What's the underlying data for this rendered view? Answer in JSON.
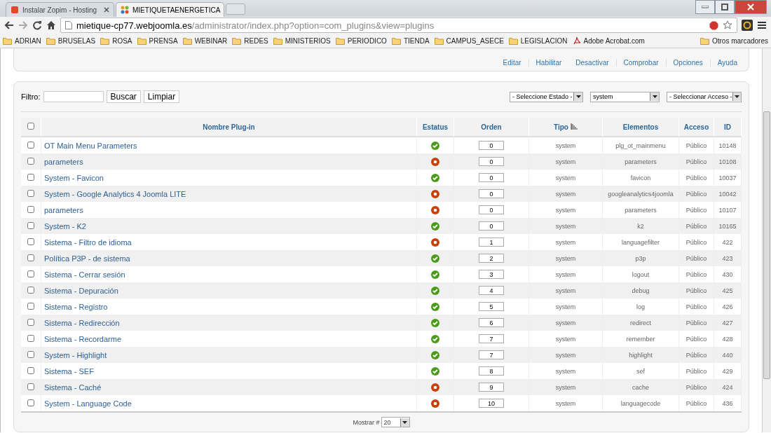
{
  "browser": {
    "tabs": [
      {
        "label": "Instalar Zopim - Hosting",
        "selected": false
      },
      {
        "label": "MIETIQUETAENERGETICA",
        "selected": true
      }
    ],
    "address": {
      "host": "mietique-cp77.webjoomla.es",
      "path": "/administrator/index.php?option=com_plugins&view=plugins"
    },
    "bookmarks": [
      {
        "label": "ADRIAN",
        "kind": "folder"
      },
      {
        "label": "BRUSELAS",
        "kind": "folder"
      },
      {
        "label": "ROSA",
        "kind": "folder"
      },
      {
        "label": "PRENSA",
        "kind": "folder"
      },
      {
        "label": "WEBINAR",
        "kind": "folder"
      },
      {
        "label": "REDES",
        "kind": "folder"
      },
      {
        "label": "MINISTERIOS",
        "kind": "folder"
      },
      {
        "label": "PERIODICO",
        "kind": "folder"
      },
      {
        "label": "TIENDA",
        "kind": "folder"
      },
      {
        "label": "CAMPUS_ASECE",
        "kind": "folder"
      },
      {
        "label": "LEGISLACION",
        "kind": "folder"
      },
      {
        "label": "Adobe Acrobat.com",
        "kind": "pdf"
      }
    ],
    "other_bookmarks": "Otros marcadores"
  },
  "toolbar": [
    "Editar",
    "Habilitar",
    "Desactivar",
    "Comprobar",
    "Opciones",
    "Ayuda"
  ],
  "filter": {
    "label": "Filtro:",
    "buttons": [
      "Buscar",
      "Limpiar"
    ],
    "selects": [
      "- Seleccione Estado -",
      "system",
      "- Seleccionar Acceso -"
    ]
  },
  "table": {
    "select_all_checked": false,
    "columns": [
      "Nombre Plug-in",
      "Estatus",
      "Orden",
      "Tipo",
      "Elementos",
      "Acceso",
      "ID"
    ],
    "rows": [
      {
        "checked": false,
        "name": "OT Main Menu Parameters",
        "enabled": true,
        "order": "0",
        "type": "system",
        "element": "plg_ot_mainmenu",
        "access": "Público",
        "id": "10148"
      },
      {
        "checked": false,
        "name": "parameters",
        "enabled": false,
        "order": "0",
        "type": "system",
        "element": "parameters",
        "access": "Público",
        "id": "10108"
      },
      {
        "checked": false,
        "name": "System - Favicon",
        "enabled": true,
        "order": "0",
        "type": "system",
        "element": "favicon",
        "access": "Público",
        "id": "10037"
      },
      {
        "checked": false,
        "name": "System - Google Analytics 4 Joomla LITE",
        "enabled": false,
        "order": "0",
        "type": "system",
        "element": "googleanalytics4joomla",
        "access": "Público",
        "id": "10042"
      },
      {
        "checked": false,
        "name": "parameters",
        "enabled": false,
        "order": "0",
        "type": "system",
        "element": "parameters",
        "access": "Público",
        "id": "10107"
      },
      {
        "checked": false,
        "name": "System - K2",
        "enabled": true,
        "order": "0",
        "type": "system",
        "element": "k2",
        "access": "Público",
        "id": "10165"
      },
      {
        "checked": false,
        "name": "Sistema - Filtro de idioma",
        "enabled": false,
        "order": "1",
        "type": "system",
        "element": "languagefilter",
        "access": "Público",
        "id": "422"
      },
      {
        "checked": false,
        "name": "Política P3P - de sistema",
        "enabled": true,
        "order": "2",
        "type": "system",
        "element": "p3p",
        "access": "Público",
        "id": "423"
      },
      {
        "checked": false,
        "name": "Sistema - Cerrar sesión",
        "enabled": true,
        "order": "3",
        "type": "system",
        "element": "logout",
        "access": "Público",
        "id": "430"
      },
      {
        "checked": false,
        "name": "Sistema - Depuración",
        "enabled": true,
        "order": "4",
        "type": "system",
        "element": "debug",
        "access": "Público",
        "id": "425"
      },
      {
        "checked": false,
        "name": "Sistema - Registro",
        "enabled": true,
        "order": "5",
        "type": "system",
        "element": "log",
        "access": "Público",
        "id": "426"
      },
      {
        "checked": false,
        "name": "Sistema - Redirección",
        "enabled": true,
        "order": "6",
        "type": "system",
        "element": "redirect",
        "access": "Público",
        "id": "427"
      },
      {
        "checked": false,
        "name": "Sistema - Recordarme",
        "enabled": true,
        "order": "7",
        "type": "system",
        "element": "remember",
        "access": "Público",
        "id": "428"
      },
      {
        "checked": false,
        "name": "System - Highlight",
        "enabled": true,
        "order": "7",
        "type": "system",
        "element": "highlight",
        "access": "Público",
        "id": "440"
      },
      {
        "checked": false,
        "name": "Sistema - SEF",
        "enabled": true,
        "order": "8",
        "type": "system",
        "element": "sef",
        "access": "Público",
        "id": "429"
      },
      {
        "checked": false,
        "name": "Sistema - Caché",
        "enabled": false,
        "order": "9",
        "type": "system",
        "element": "cache",
        "access": "Público",
        "id": "424"
      },
      {
        "checked": false,
        "name": "System - Language Code",
        "enabled": false,
        "order": "10",
        "type": "system",
        "element": "languagecode",
        "access": "Público",
        "id": "436"
      }
    ]
  },
  "pagination": {
    "label": "Mostrar #",
    "value": "20"
  }
}
